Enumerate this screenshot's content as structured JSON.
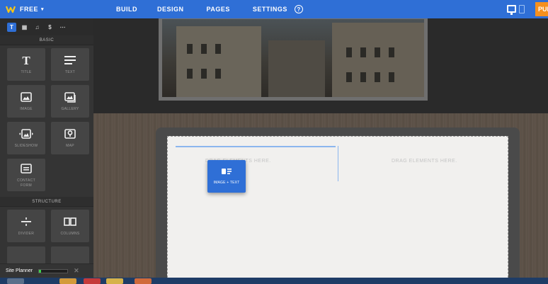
{
  "topbar": {
    "brand_label": "FREE",
    "brand_caret": "▾",
    "logo_icon": "weebly-logo",
    "nav": [
      "BUILD",
      "DESIGN",
      "PAGES",
      "SETTINGS"
    ],
    "help_glyph": "?",
    "publish_label": "PUBLISH",
    "colors": {
      "bar": "#2f6fd6",
      "publish": "#f5901e"
    }
  },
  "sidebar": {
    "tabs": [
      {
        "glyph": "T",
        "icon": "text-icon",
        "active": true
      },
      {
        "glyph": "▦",
        "icon": "layout-icon",
        "active": false
      },
      {
        "glyph": "♫",
        "icon": "media-icon",
        "active": false
      },
      {
        "glyph": "$",
        "icon": "commerce-icon",
        "active": false
      },
      {
        "glyph": "⋯",
        "icon": "more-icon",
        "active": false
      }
    ],
    "basic_label": "BASIC",
    "elements": [
      {
        "label": "TITLE",
        "icon": "title-icon"
      },
      {
        "label": "TEXT",
        "icon": "text-lines-icon"
      },
      {
        "label": "IMAGE",
        "icon": "image-icon"
      },
      {
        "label": "GALLERY",
        "icon": "gallery-icon"
      },
      {
        "label": "SLIDESHOW",
        "icon": "slideshow-icon"
      },
      {
        "label": "MAP",
        "icon": "map-pin-icon"
      },
      {
        "label": "CONTACT FORM",
        "icon": "form-icon"
      }
    ],
    "structure_label": "STRUCTURE",
    "structure_elements": [
      {
        "label": "DIVIDER",
        "icon": "divider-icon"
      },
      {
        "label": "COLUMNS",
        "icon": "columns-icon"
      }
    ],
    "site_planner": {
      "label": "Site Planner",
      "progress": 0.08,
      "close_glyph": "✕"
    }
  },
  "canvas": {
    "drop_text_left": "DRAG ELEMENTS HERE.",
    "drop_text_right": "DRAG ELEMENTS HERE.",
    "drag_card": {
      "label": "IMAGE + TEXT",
      "icon": "image-text-icon"
    }
  }
}
